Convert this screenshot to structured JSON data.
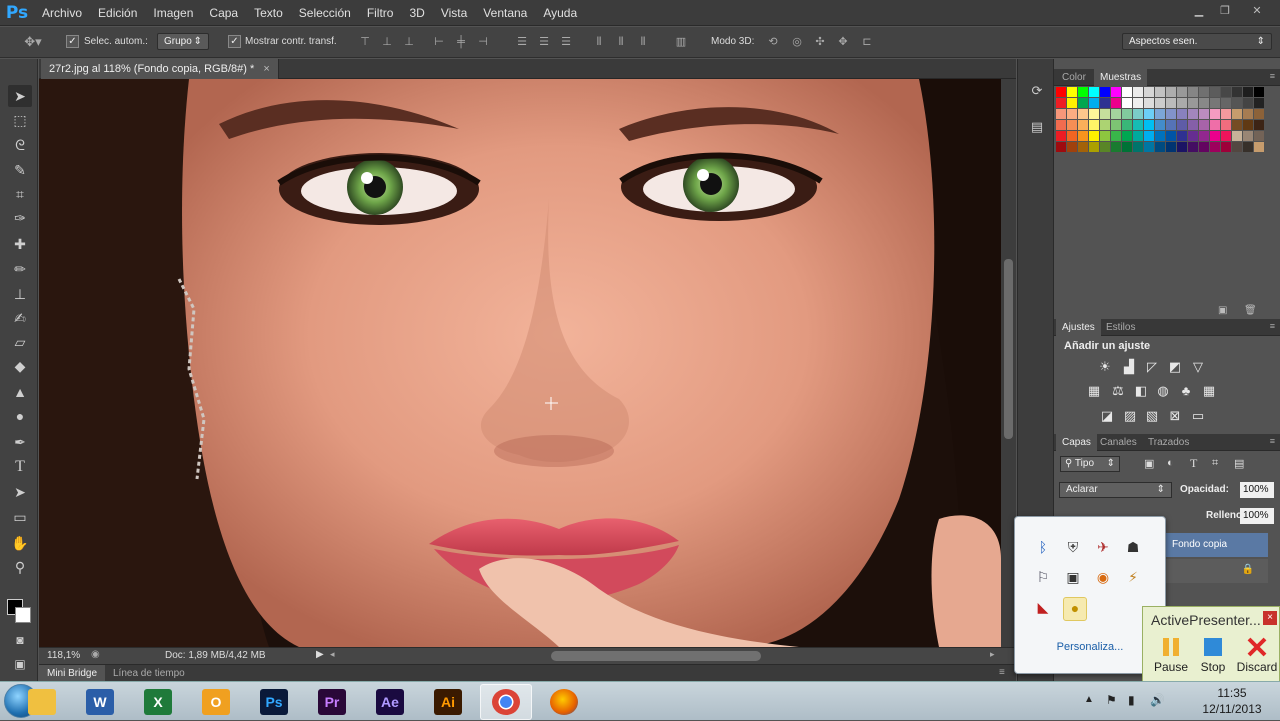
{
  "app": {
    "logo": "Ps"
  },
  "menu": [
    "Archivo",
    "Edición",
    "Imagen",
    "Capa",
    "Texto",
    "Selección",
    "Filtro",
    "3D",
    "Vista",
    "Ventana",
    "Ayuda"
  ],
  "options": {
    "auto_select_label": "Selec. autom.:",
    "auto_select_value": "Grupo",
    "show_transform_label": "Mostrar contr. transf.",
    "mode3d_label": "Modo 3D:",
    "workspace": "Aspectos esen."
  },
  "document": {
    "tab_title": "27r2.jpg al 118% (Fondo copia, RGB/8#) *",
    "zoom": "118,1%",
    "doc_size": "Doc: 1,89 MB/4,42 MB"
  },
  "bottom_tabs": {
    "mini_bridge": "Mini Bridge",
    "timeline": "Línea de tiempo"
  },
  "panels": {
    "color_tab": "Color",
    "swatches_tab": "Muestras",
    "adjustments_tab": "Ajustes",
    "styles_tab": "Estilos",
    "add_adjustment": "Añadir un ajuste",
    "layers_tab": "Capas",
    "channels_tab": "Canales",
    "paths_tab": "Trazados",
    "kind_filter": "Tipo",
    "blend_mode": "Aclarar",
    "opacity_label": "Opacidad:",
    "opacity_value": "100%",
    "fill_label": "Relleno:",
    "fill_value": "100%",
    "layer_name": "Fondo copia"
  },
  "tray_popup": {
    "customize": "Personaliza..."
  },
  "activepresenter": {
    "title": "ActivePresenter...",
    "pause": "Pause",
    "stop": "Stop",
    "discard": "Discard"
  },
  "clock": {
    "time": "11:35",
    "date": "12/11/2013"
  },
  "taskbar_apps": [
    {
      "name": "explorer",
      "label": ""
    },
    {
      "name": "word",
      "label": "W"
    },
    {
      "name": "excel",
      "label": "X"
    },
    {
      "name": "outlook",
      "label": "O"
    },
    {
      "name": "photoshop",
      "label": "Ps"
    },
    {
      "name": "premiere",
      "label": "Pr"
    },
    {
      "name": "after-effects",
      "label": "Ae"
    },
    {
      "name": "illustrator",
      "label": "Ai"
    },
    {
      "name": "chrome",
      "label": ""
    },
    {
      "name": "firefox",
      "label": ""
    }
  ],
  "colors": {
    "ps_accent": "#31a8ff",
    "layer_selected": "#5a79a4"
  }
}
